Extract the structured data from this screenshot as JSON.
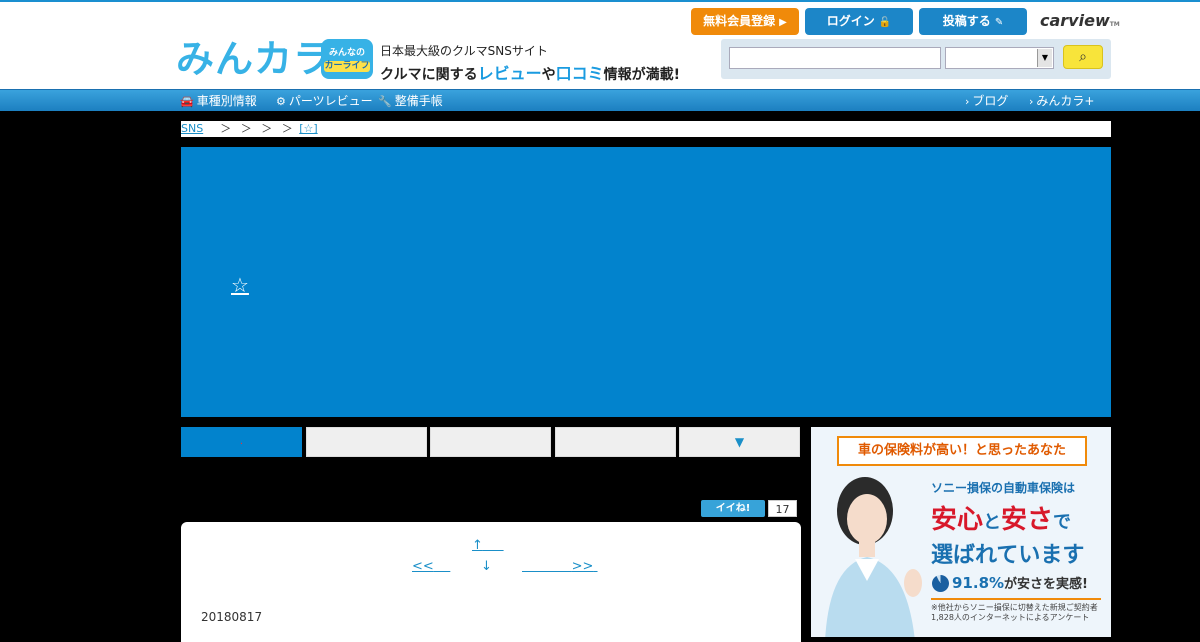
{
  "header": {
    "logo": "みんカラ",
    "logo_tm": "TM",
    "badge_line1": "みんなの",
    "badge_line2": "カーライフ",
    "tagline1": "日本最大級のクルマSNSサイト",
    "tagline2_pre": "クルマに関する",
    "tagline2_review": "レビュー",
    "tagline2_mid": "や",
    "tagline2_kuchikomi": "口コミ",
    "tagline2_post": "情報が満載!",
    "buttons": {
      "register": "無料会員登録",
      "login": "ログイン",
      "post": "投稿する"
    },
    "carview": "carview",
    "carview_tm": "TM",
    "search": {
      "input_value": "",
      "select_value": ""
    }
  },
  "nav": {
    "left": [
      {
        "icon": "car-icon",
        "label": "車種別情報"
      },
      {
        "icon": "parts-icon",
        "label": "パーツレビュー"
      },
      {
        "icon": "wrench-icon",
        "label": "整備手帳"
      }
    ],
    "right": [
      {
        "label": "ブログ"
      },
      {
        "label": "みんカラ+"
      }
    ]
  },
  "breadcrumb": {
    "first": "SNS",
    "separators": [
      "＞",
      "＞",
      "＞",
      "＞"
    ],
    "last": "[☆]"
  },
  "hero": {
    "star": "☆"
  },
  "tabs": [
    {
      "label": ".",
      "active": true
    },
    {
      "label": "",
      "active": false
    },
    {
      "label": "",
      "active": false
    },
    {
      "label": "",
      "active": false
    },
    {
      "label": "▼",
      "active": false
    }
  ],
  "like": {
    "button": "イイね!",
    "count": "17"
  },
  "content": {
    "pager_up": "↑",
    "pager_prev": "<<",
    "pager_mid": "↓",
    "pager_next": ">>",
    "date": "20180817"
  },
  "ad": {
    "headline": "車の保険料が高い！と思ったあなた",
    "line1": "ソニー損保の自動車保険は",
    "line2a": "安心",
    "line2b": "と",
    "line2c": "安さ",
    "line2d": "で",
    "line3": "選ばれています",
    "stat": "91.8",
    "stat_unit": "%",
    "stat_text": "が安さを実感!",
    "note": "※他社からソニー損保に切替えた新規ご契約者 1,828人のインターネットによるアンケート",
    "stat_fraction": 0.918
  }
}
